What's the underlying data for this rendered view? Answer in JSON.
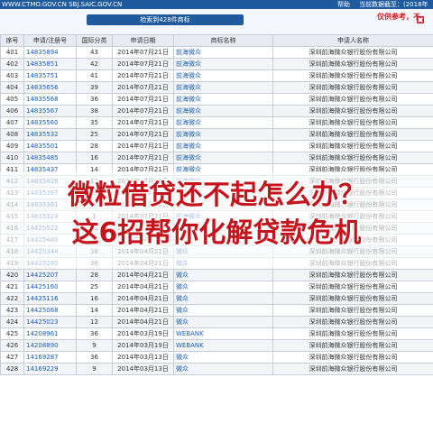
{
  "header": {
    "site": "WWW.CTMO.GOV.CN SBJ.SAIC.GOV.CN",
    "help": "帮助",
    "deadline": "当前数据截至：(2018年"
  },
  "info": {
    "count_label": "检索到428件商标",
    "note": "仅供参考，不"
  },
  "columns": [
    "序号",
    "申请/注册号",
    "国际分类",
    "申请日期",
    "商标名称",
    "申请人名称"
  ],
  "rows": [
    [
      "401",
      "14835894",
      "43",
      "2014年07月21日",
      "前海微众",
      "深圳前海微众银行股份有限公司"
    ],
    [
      "402",
      "14835851",
      "42",
      "2014年07月21日",
      "前海微众",
      "深圳前海微众银行股份有限公司"
    ],
    [
      "403",
      "14835751",
      "41",
      "2014年07月21日",
      "前海微众",
      "深圳前海微众银行股份有限公司"
    ],
    [
      "404",
      "14835656",
      "39",
      "2014年07月21日",
      "前海微众",
      "深圳前海微众银行股份有限公司"
    ],
    [
      "405",
      "14835568",
      "36",
      "2014年07月21日",
      "前海微众",
      "深圳前海微众银行股份有限公司"
    ],
    [
      "406",
      "14835567",
      "38",
      "2014年07月21日",
      "前海微众",
      "深圳前海微众银行股份有限公司"
    ],
    [
      "407",
      "14835560",
      "35",
      "2014年07月21日",
      "前海微众",
      "深圳前海微众银行股份有限公司"
    ],
    [
      "408",
      "14835532",
      "25",
      "2014年07月21日",
      "前海微众",
      "深圳前海微众银行股份有限公司"
    ],
    [
      "409",
      "14835501",
      "28",
      "2014年07月21日",
      "前海微众",
      "深圳前海微众银行股份有限公司"
    ],
    [
      "410",
      "14835485",
      "16",
      "2014年07月21日",
      "前海微众",
      "深圳前海微众银行股份有限公司"
    ],
    [
      "411",
      "14835437",
      "14",
      "2014年07月21日",
      "前海微众",
      "深圳前海微众银行股份有限公司"
    ],
    [
      "412",
      "14835426",
      "12",
      "2014年07月21日",
      "前海微众",
      "深圳前海微众银行股份有限公司"
    ],
    [
      "413",
      "14835397",
      "9",
      "2014年07月21日",
      "前海微众",
      "深圳前海微众银行股份有限公司"
    ],
    [
      "414",
      "14835361",
      "3",
      "2014年07月21日",
      "前海微众",
      "深圳前海微众银行股份有限公司"
    ],
    [
      "415",
      "14835324",
      "1",
      "2014年07月21日",
      "前海微众",
      "深圳前海微众银行股份有限公司"
    ],
    [
      "416",
      "14425522",
      "42",
      "2014年04月21日",
      "微众",
      "深圳前海微众银行股份有限公司"
    ],
    [
      "417",
      "14425440",
      "41",
      "2014年04月21日",
      "微众",
      "深圳前海微众银行股份有限公司"
    ],
    [
      "418",
      "14425344",
      "38",
      "2014年04月21日",
      "微众",
      "深圳前海微众银行股份有限公司"
    ],
    [
      "419",
      "14425280",
      "36",
      "2014年04月21日",
      "微众",
      "深圳前海微众银行股份有限公司"
    ],
    [
      "420",
      "14425207",
      "28",
      "2014年04月21日",
      "微众",
      "深圳前海微众银行股份有限公司"
    ],
    [
      "421",
      "14425160",
      "25",
      "2014年04月21日",
      "微众",
      "深圳前海微众银行股份有限公司"
    ],
    [
      "422",
      "14425116",
      "16",
      "2014年04月21日",
      "微众",
      "深圳前海微众银行股份有限公司"
    ],
    [
      "423",
      "14425068",
      "14",
      "2014年04月21日",
      "微众",
      "深圳前海微众银行股份有限公司"
    ],
    [
      "424",
      "14425023",
      "12",
      "2014年04月21日",
      "微众",
      "深圳前海微众银行股份有限公司"
    ],
    [
      "425",
      "14208961",
      "36",
      "2014年03月19日",
      "WEBANK",
      "深圳前海微众银行股份有限公司"
    ],
    [
      "426",
      "14208890",
      "9",
      "2014年03月19日",
      "WEBANK",
      "深圳前海微众银行股份有限公司"
    ],
    [
      "427",
      "14169287",
      "36",
      "2014年03月13日",
      "微众",
      "深圳前海微众银行股份有限公司"
    ],
    [
      "428",
      "14169229",
      "9",
      "2014年03月13日",
      "微众",
      "深圳前海微众银行股份有限公司"
    ]
  ],
  "overlay": {
    "line1": "微粒借贷还不起怎么办？",
    "line2": "这6招帮你化解贷款危机"
  },
  "colors": {
    "header_blue": "#1f5a9c",
    "link_blue": "#1a5fb4",
    "accent_red": "#d71920",
    "headline_red": "#c4151c"
  }
}
